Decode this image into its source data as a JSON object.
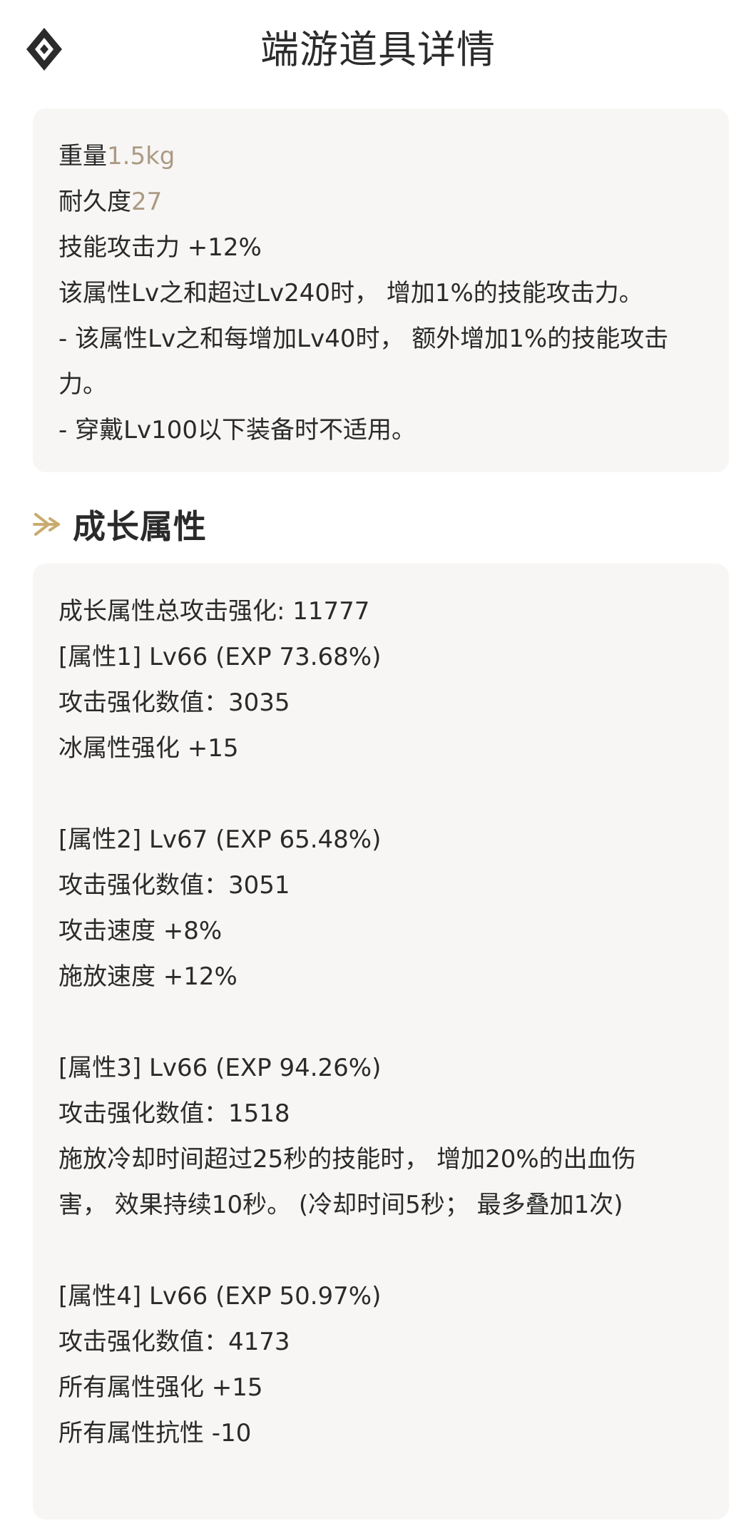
{
  "header": {
    "title": "端游道具详情",
    "logo_icon": "diamond-logo-icon"
  },
  "info": {
    "weight_label": "重量",
    "weight_value": "1.5kg",
    "durability_label": "耐久度",
    "durability_value": "27",
    "lines": [
      "技能攻击力 +12%",
      "该属性Lv之和超过Lv240时， 增加1%的技能攻击力。",
      "- 该属性Lv之和每增加Lv40时， 额外增加1%的技能攻击力。",
      "- 穿戴Lv100以下装备时不适用。"
    ]
  },
  "growth": {
    "section_title": "成长属性",
    "section_icon": "arrow-right-icon",
    "total": "成长属性总攻击强化: 11777",
    "attr1": {
      "header": "[属性1] Lv66 (EXP 73.68%)",
      "lines": [
        "攻击强化数值：3035",
        "冰属性强化 +15"
      ]
    },
    "attr2": {
      "header": "[属性2] Lv67 (EXP 65.48%)",
      "lines": [
        "攻击强化数值：3051",
        "攻击速度 +8%",
        "施放速度 +12%"
      ]
    },
    "attr3": {
      "header": "[属性3] Lv66 (EXP 94.26%)",
      "lines": [
        "攻击强化数值：1518",
        "施放冷却时间超过25秒的技能时， 增加20%的出血伤害， 效果持续10秒。 (冷却时间5秒； 最多叠加1次)"
      ]
    },
    "attr4": {
      "header": "[属性4] Lv66 (EXP 50.97%)",
      "lines": [
        "攻击强化数值：4173",
        "所有属性强化 +15",
        "所有属性抗性 -10"
      ]
    }
  },
  "colors": {
    "accent_gold": "#c9ab6e",
    "muted_value": "#ab9a84",
    "card_bg": "#f7f6f4",
    "text": "#2a2a2a"
  }
}
